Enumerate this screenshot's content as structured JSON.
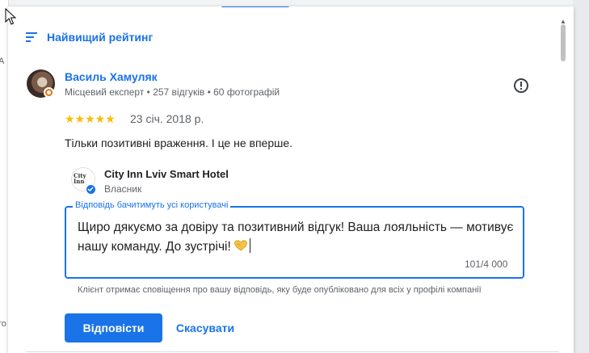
{
  "background": {
    "left_fragments": [
      "А",
      "го"
    ]
  },
  "sort": {
    "label": "Найвищий рейтинг",
    "icon": "sort-icon"
  },
  "review": {
    "author": "Василь Хамуляк",
    "author_meta": "Місцевий експерт • 257 відгуків • 60 фотографій",
    "rating": 5,
    "stars_text": "★★★★★",
    "date": "23 січ. 2018 р.",
    "text": "Тільки позитивні враження. І це не вперше.",
    "flag_icon": "report-flag-icon"
  },
  "owner": {
    "name": "City Inn Lviv Smart Hotel",
    "role": "Власник",
    "logo_text": "City Inn"
  },
  "reply": {
    "legend": "Відповідь бачитимуть усі користувачі",
    "text": "Щиро дякуємо за довіру та позитивний відгук! Ваша лояльність — мотивує нашу команду. До зустрічі!",
    "emoji_icon": "yellow-heart-icon",
    "counter": "101/4 000",
    "notice": "Клієнт отримає сповіщення про вашу відповідь, яку буде опубліковано для всіх у профілі компанії"
  },
  "actions": {
    "reply_label": "Відповісти",
    "cancel_label": "Скасувати"
  },
  "colors": {
    "accent": "#1a73e8",
    "star": "#fbbc04",
    "badge": "#e8710a",
    "text": "#202124",
    "muted": "#5f6368"
  }
}
